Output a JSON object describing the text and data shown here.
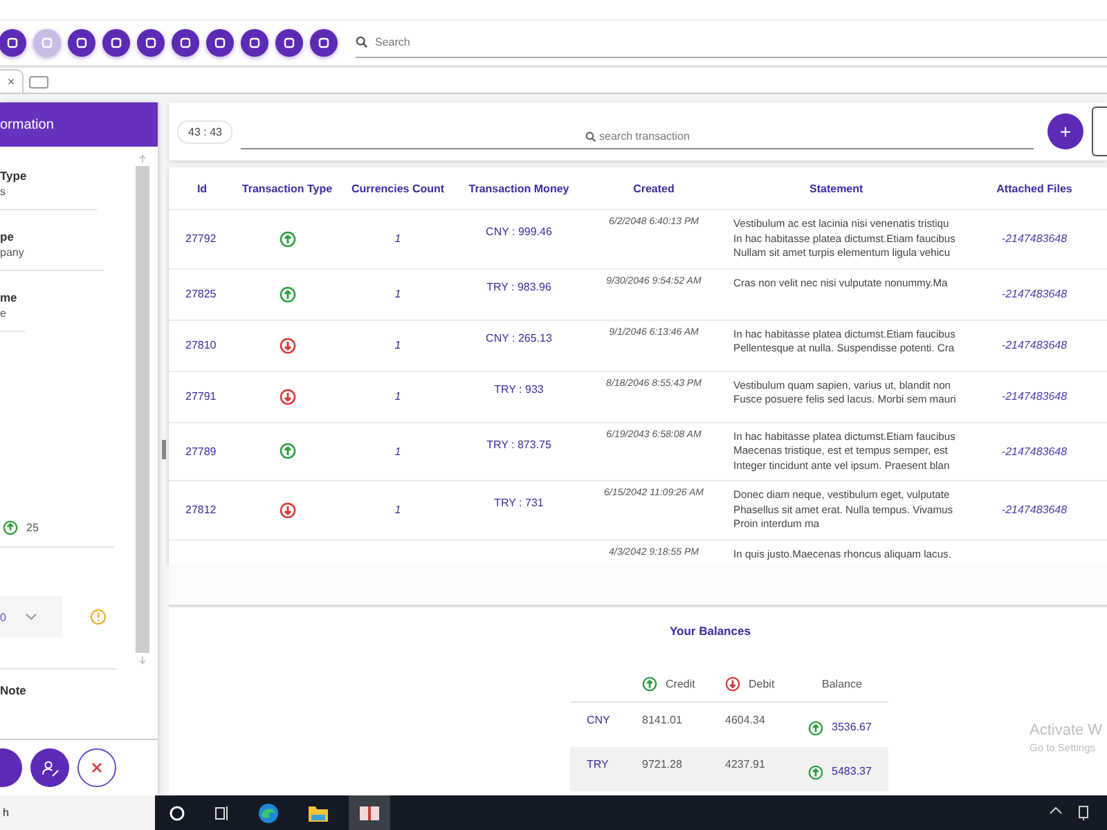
{
  "toolbar_buttons": [
    {
      "disabled": false
    },
    {
      "disabled": true
    },
    {
      "disabled": false
    },
    {
      "disabled": false
    },
    {
      "disabled": false
    },
    {
      "disabled": false
    },
    {
      "disabled": false
    },
    {
      "disabled": false
    },
    {
      "disabled": false
    },
    {
      "disabled": false
    }
  ],
  "search": {
    "placeholder": "Search"
  },
  "tab": {
    "close": "×"
  },
  "panel": {
    "title": "ormation",
    "fields": [
      {
        "label": "Type",
        "value": "s"
      },
      {
        "label": "pe",
        "value": "pany"
      },
      {
        "label": "me",
        "value": "e"
      }
    ],
    "amount": {
      "kind": "credit",
      "value": "25"
    },
    "dropdown": {
      "value": "0"
    },
    "note_label": "Note"
  },
  "counter": "43 : 43",
  "transaction_search": {
    "placeholder": "search transaction"
  },
  "add_button": "+",
  "table": {
    "columns": [
      "Id",
      "Transaction Type",
      "Currencies Count",
      "Transaction Money",
      "Created",
      "Statement",
      "Attached Files"
    ],
    "rows": [
      {
        "id": "27792",
        "kind": "credit",
        "count": "1",
        "money": "CNY : 999.46",
        "created": "6/2/2048 6:40:13 PM",
        "statement": [
          "Vestibulum ac est lacinia nisi venenatis tristiqu",
          "In hac habitasse platea dictumst.Etiam faucibus",
          "Nullam sit amet turpis elementum ligula vehicu"
        ],
        "files": "-2147483648"
      },
      {
        "id": "27825",
        "kind": "credit",
        "count": "1",
        "money": "TRY : 983.96",
        "created": "9/30/2046 9:54:52 AM",
        "statement": [
          "Cras non velit nec nisi vulputate nonummy.Ma"
        ],
        "files": "-2147483648"
      },
      {
        "id": "27810",
        "kind": "debit",
        "count": "1",
        "money": "CNY : 265.13",
        "created": "9/1/2046 6:13:46 AM",
        "statement": [
          "In hac habitasse platea dictumst.Etiam faucibus",
          "Pellentesque at nulla. Suspendisse potenti. Cra"
        ],
        "files": "-2147483648"
      },
      {
        "id": "27791",
        "kind": "debit",
        "count": "1",
        "money": "TRY : 933",
        "created": "8/18/2046 8:55:43 PM",
        "statement": [
          "Vestibulum quam sapien, varius ut, blandit non",
          "Fusce posuere felis sed lacus. Morbi sem mauri"
        ],
        "files": "-2147483648"
      },
      {
        "id": "27789",
        "kind": "credit",
        "count": "1",
        "money": "TRY : 873.75",
        "created": "6/19/2043 6:58:08 AM",
        "statement": [
          "In hac habitasse platea dictumst.Etiam faucibus",
          "Maecenas tristique, est et tempus semper, est",
          "Integer tincidunt ante vel ipsum. Praesent blan"
        ],
        "files": "-2147483648"
      },
      {
        "id": "27812",
        "kind": "debit",
        "count": "1",
        "money": "TRY : 731",
        "created": "6/15/2042 11:09:26 AM",
        "statement": [
          "Donec diam neque, vestibulum eget, vulputate",
          "Phasellus sit amet erat. Nulla tempus. Vivamus",
          "Proin interdum ma"
        ],
        "files": "-2147483648"
      },
      {
        "created": "4/3/2042 9:18:55 PM",
        "statement": [
          "In quis justo.Maecenas rhoncus aliquam lacus."
        ]
      }
    ]
  },
  "balances": {
    "title": "Your Balances",
    "columns": [
      {
        "label": "Credit",
        "kind": "credit"
      },
      {
        "label": "Debit",
        "kind": "debit"
      },
      {
        "label": "Balance"
      }
    ],
    "rows": [
      {
        "currency": "CNY",
        "credit": "8141.01",
        "debit": "4604.34",
        "kind": "credit",
        "balance": "3536.67",
        "selected": false
      },
      {
        "currency": "TRY",
        "credit": "9721.28",
        "debit": "4237.91",
        "kind": "credit",
        "balance": "5483.37",
        "selected": true
      }
    ]
  },
  "activation_notice": {
    "title": "Activate W",
    "subtitle": "Go to Settings"
  },
  "taskbar": {
    "search": "h"
  }
}
